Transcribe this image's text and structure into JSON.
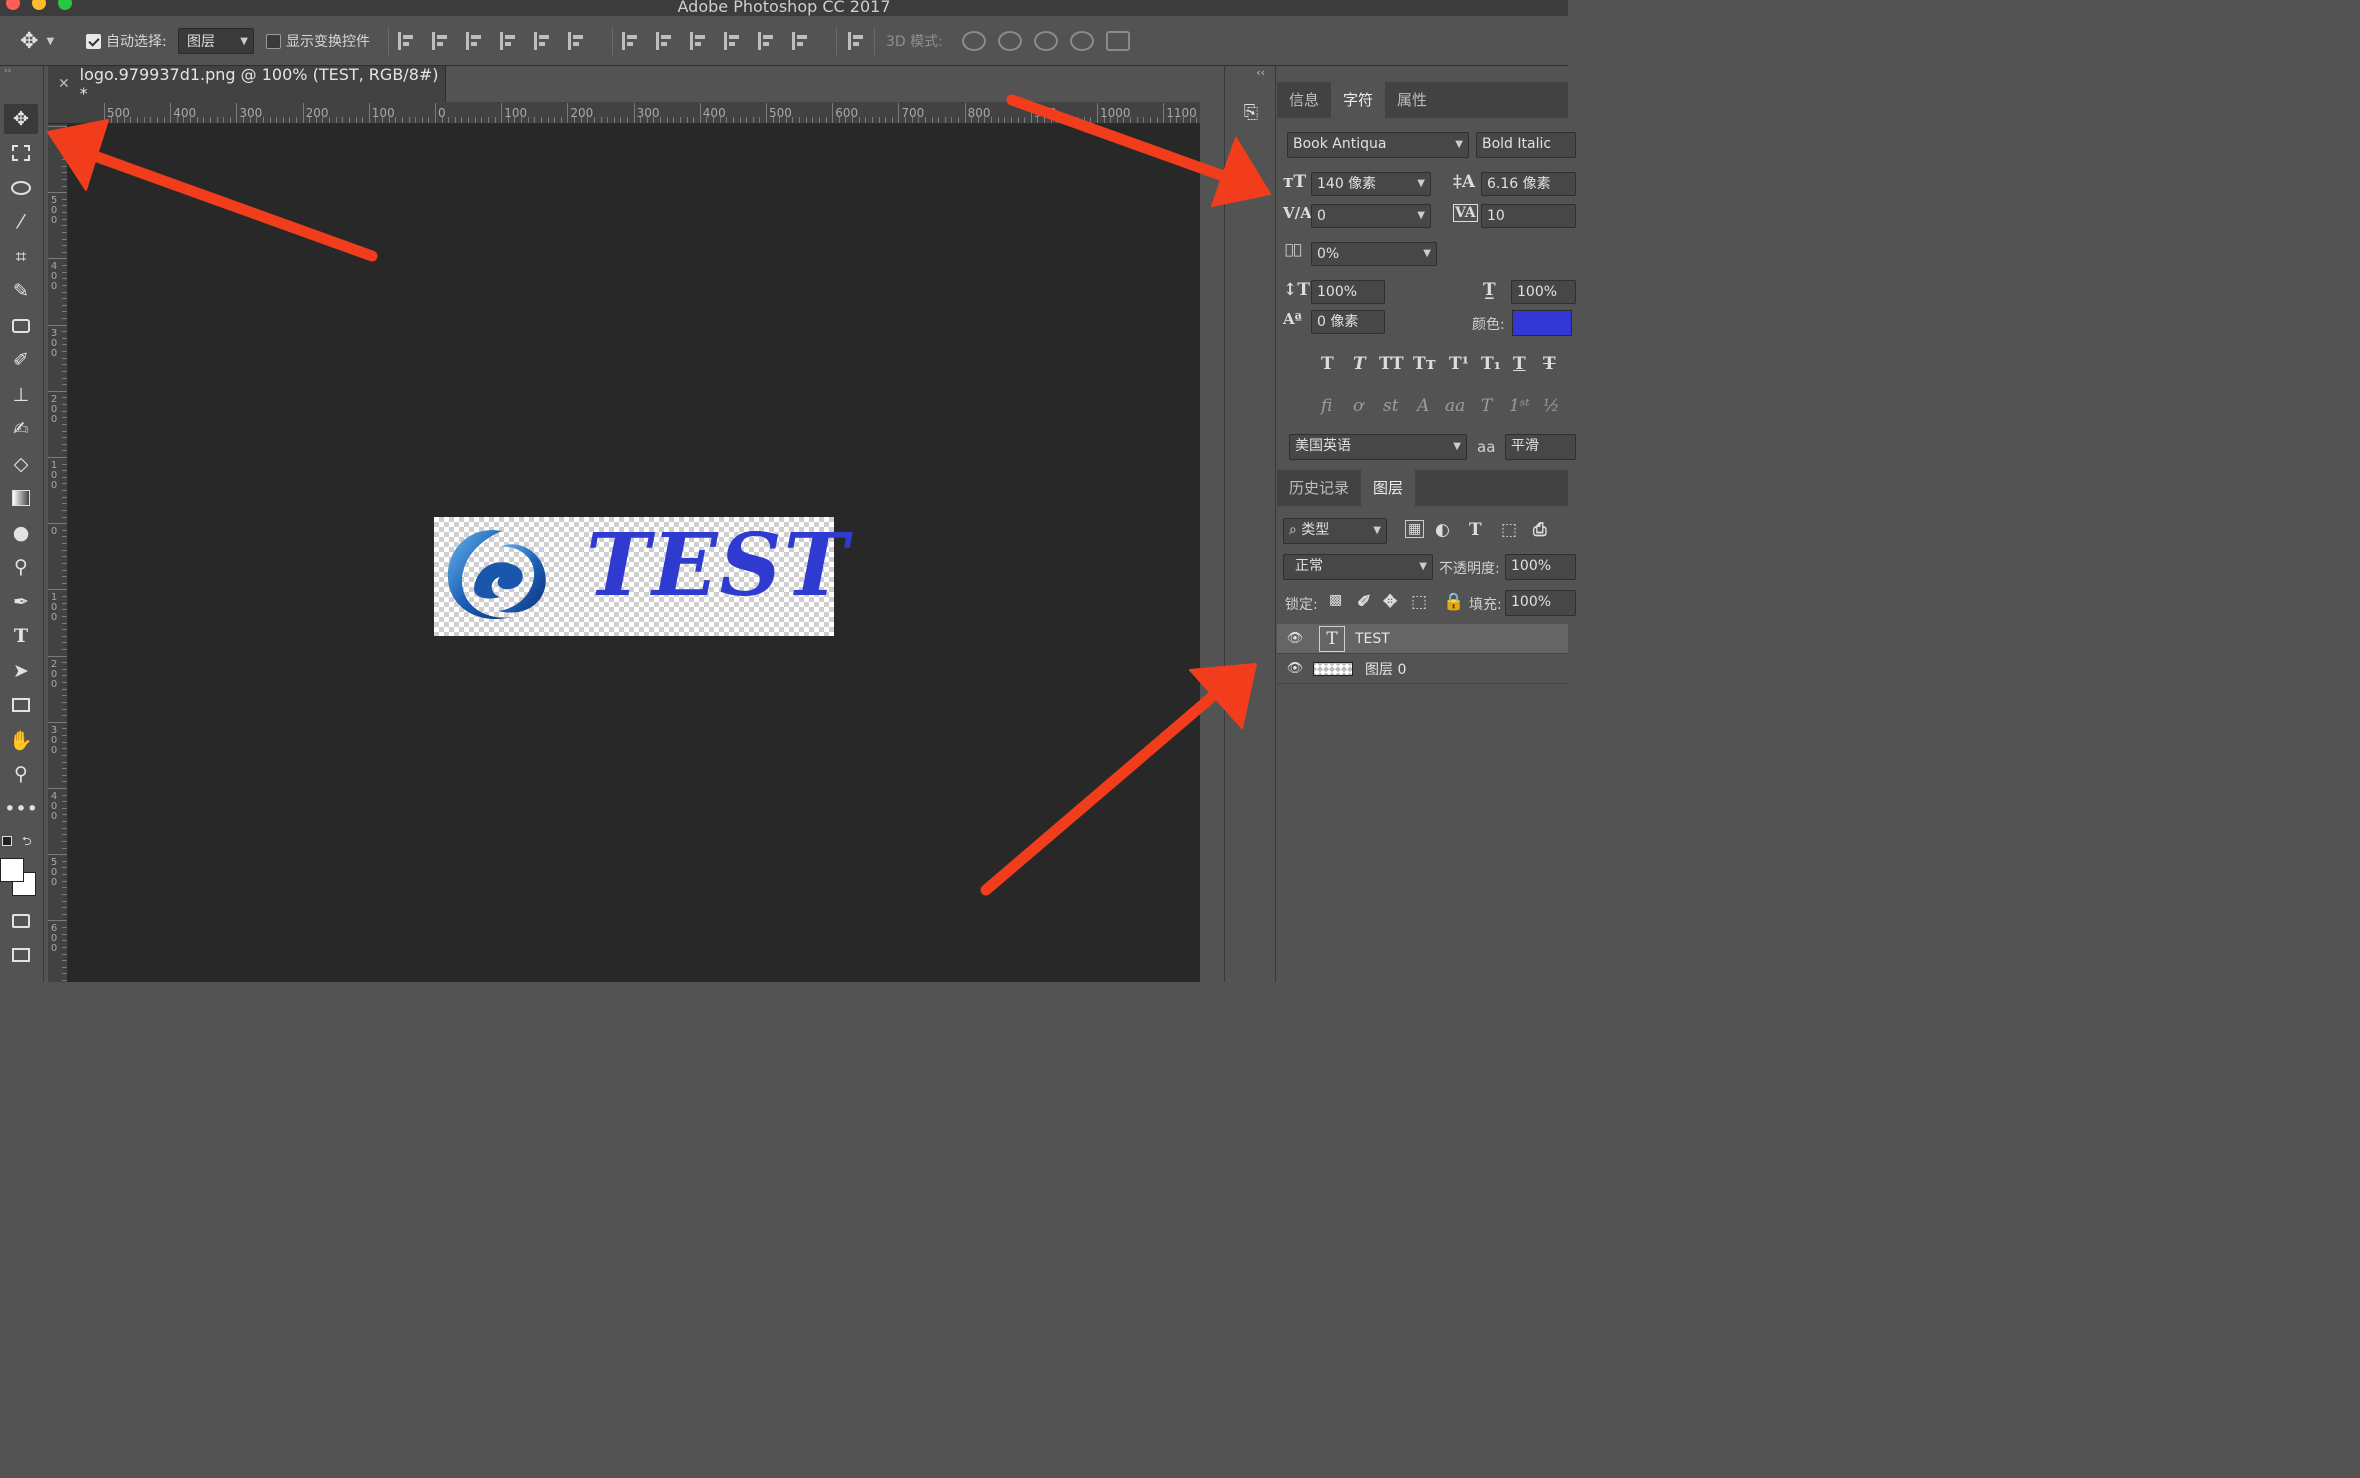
{
  "app": {
    "title": "Adobe Photoshop CC 2017"
  },
  "options_bar": {
    "auto_select_label": "自动选择:",
    "auto_select_target": "图层",
    "show_transform_label": "显示变换控件",
    "mode_3d_label": "3D 模式:"
  },
  "document": {
    "tab_title": "logo.979937d1.png @ 100% (TEST, RGB/8#) *",
    "artwork_text": "TEST",
    "artwork_text_color": "#2f3ad0"
  },
  "ruler": {
    "h_labels": [
      "500",
      "400",
      "300",
      "200",
      "100",
      "0",
      "100",
      "200",
      "300",
      "400",
      "500",
      "600",
      "700",
      "800",
      "900",
      "1000",
      "1100"
    ],
    "v_labels": [
      "0",
      "5 0 0",
      "4 0 0",
      "3 0 0",
      "2 0 0",
      "1 0 0",
      "0",
      "1 0 0",
      "2 0 0",
      "3 0 0",
      "4 0 0",
      "5 0 0",
      "6 0 0"
    ]
  },
  "tools": [
    "move-icon",
    "marquee-icon",
    "lasso-icon",
    "magic-wand-icon",
    "crop-icon",
    "eyedropper-icon",
    "patch-icon",
    "brush-icon",
    "stamp-icon",
    "history-brush-icon",
    "eraser-icon",
    "gradient-icon",
    "blur-icon",
    "dodge-icon",
    "pen-icon",
    "type-icon",
    "path-select-icon",
    "rectangle-icon",
    "hand-icon",
    "zoom-icon",
    "more-icon"
  ],
  "top_panel": {
    "tabs": [
      "信息",
      "字符",
      "属性"
    ],
    "active_tab": "字符",
    "font_family": "Book Antiqua",
    "font_style": "Bold Italic",
    "font_size": "140 像素",
    "leading": "6.16 像素",
    "kerning": "0",
    "tracking": "10",
    "scale_percent": "0%",
    "vertical_scale": "100%",
    "horizontal_scale": "100%",
    "baseline_shift": "0 像素",
    "color_label": "颜色:",
    "color_value": "#3338d4",
    "language": "美国英语",
    "aa_label": "aa",
    "antialias": "平滑"
  },
  "layers_panel": {
    "tabs": [
      "历史记录",
      "图层"
    ],
    "active_tab": "图层",
    "filter_kind": "类型",
    "blend_mode": "正常",
    "opacity_label": "不透明度:",
    "opacity": "100%",
    "lock_label": "锁定:",
    "fill_label": "填充:",
    "fill": "100%",
    "layers": [
      {
        "name": "TEST",
        "type": "text",
        "visible": true,
        "selected": true
      },
      {
        "name": "图层 0",
        "type": "image",
        "visible": true,
        "selected": false
      }
    ]
  },
  "annotation_color": "#f23d1c"
}
